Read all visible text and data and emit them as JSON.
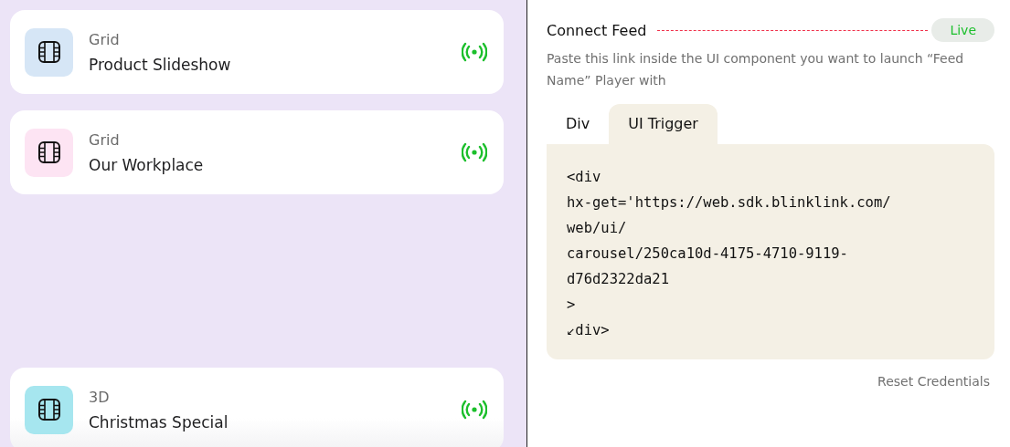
{
  "feeds": [
    {
      "type": "Grid",
      "name": "Product Slideshow",
      "color": "#d6e6f6",
      "live": true
    },
    {
      "type": "Grid",
      "name": "Our Workplace",
      "color": "#fde4f3",
      "live": true
    },
    {
      "type": "3D",
      "name": "Christmas Special",
      "color": "#a6e6ef",
      "live": true
    }
  ],
  "connect": {
    "title": "Connect Feed",
    "status": "Live",
    "description": "Paste this link inside the UI component you want to launch “Feed Name” Player with",
    "tabs": [
      {
        "label": "Div",
        "selected": false
      },
      {
        "label": "UI Trigger",
        "selected": true
      }
    ],
    "code_lines": [
      "<div",
      "hx-get='https://web.sdk.blinklink.com/",
      "web/ui/",
      "carousel/250ca10d-4175-4710-9119-",
      "d76d2322da21",
      ">",
      "↙div>"
    ],
    "reset": "Reset Credentials"
  }
}
